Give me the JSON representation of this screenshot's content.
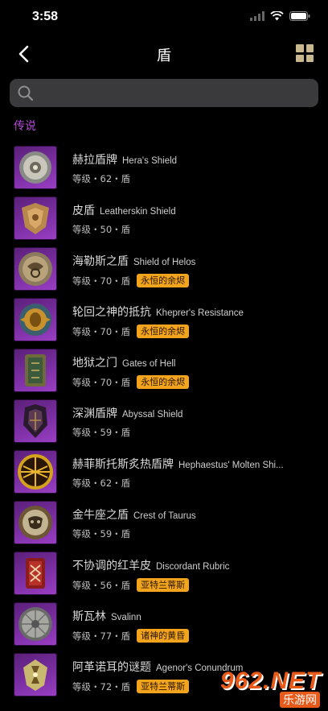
{
  "status": {
    "time": "3:58"
  },
  "nav": {
    "title": "盾"
  },
  "search": {
    "placeholder": ""
  },
  "section": {
    "title": "传说"
  },
  "items": [
    {
      "cn": "赫拉盾牌",
      "en": "Hera's Shield",
      "level": "等级・62・盾",
      "badge": "",
      "icon": "hera-shield-icon"
    },
    {
      "cn": "皮盾",
      "en": "Leatherskin Shield",
      "level": "等级・50・盾",
      "badge": "",
      "icon": "leather-shield-icon"
    },
    {
      "cn": "海勒斯之盾",
      "en": "Shield of Helos",
      "level": "等级・70・盾",
      "badge": "永恒的余烬",
      "icon": "helos-shield-icon"
    },
    {
      "cn": "轮回之神的抵抗",
      "en": "Kheprer's Resistance",
      "level": "等级・70・盾",
      "badge": "永恒的余烬",
      "icon": "kheprer-shield-icon"
    },
    {
      "cn": "地狱之门",
      "en": "Gates of Hell",
      "level": "等级・70・盾",
      "badge": "永恒的余烬",
      "icon": "gates-shield-icon"
    },
    {
      "cn": "深渊盾牌",
      "en": "Abyssal Shield",
      "level": "等级・59・盾",
      "badge": "",
      "icon": "abyssal-shield-icon"
    },
    {
      "cn": "赫菲斯托斯炙热盾牌",
      "en": "Hephaestus' Molten Shi...",
      "level": "等级・62・盾",
      "badge": "",
      "icon": "hephaestus-shield-icon"
    },
    {
      "cn": "金牛座之盾",
      "en": "Crest of Taurus",
      "level": "等级・59・盾",
      "badge": "",
      "icon": "taurus-shield-icon"
    },
    {
      "cn": "不协调的红羊皮",
      "en": "Discordant Rubric",
      "level": "等级・56・盾",
      "badge": "亚特兰蒂斯",
      "icon": "rubric-shield-icon"
    },
    {
      "cn": "斯瓦林",
      "en": "Svalinn",
      "level": "等级・77・盾",
      "badge": "诸神的黄昏",
      "icon": "svalinn-shield-icon"
    },
    {
      "cn": "阿革诺耳的谜题",
      "en": "Agenor's Conundrum",
      "level": "等级・72・盾",
      "badge": "亚特兰蒂斯",
      "icon": "agenor-shield-icon"
    }
  ],
  "watermark": {
    "number": "962.NET",
    "sub": "乐游网"
  },
  "colors": {
    "accent": "#b44bd6",
    "badge": "#f2a41c",
    "thumb": "#7b2fa3"
  }
}
